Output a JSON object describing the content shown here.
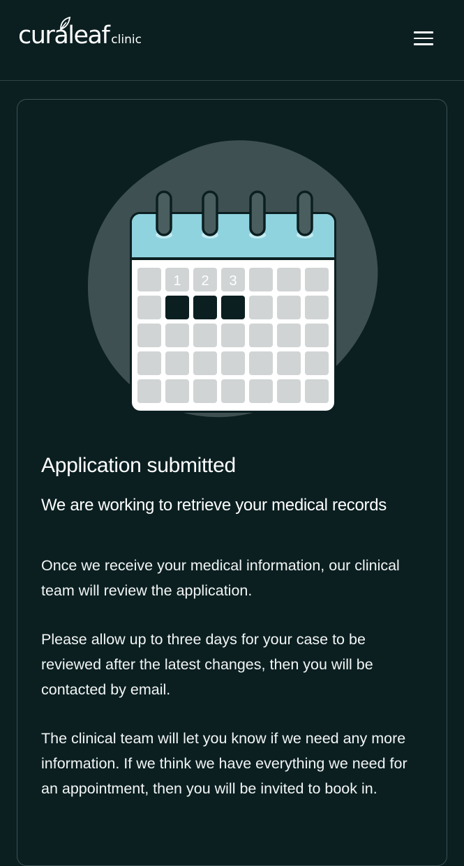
{
  "header": {
    "logo_main": "curaleaf",
    "logo_sub": "clinic"
  },
  "main": {
    "calendar_days": [
      "1",
      "2",
      "3"
    ],
    "title": "Application submitted",
    "subtitle": "We are working to retrieve your medical records",
    "paragraphs": [
      "Once we receive your medical information, our clinical team will review the application.",
      "Please allow up to three days for your case to be reviewed after the latest changes, then you will be contacted by email.",
      "The clinical team will let you know if we need any more information. If we think we have everything we need for an appointment, then you will be invited to book in."
    ]
  },
  "colors": {
    "background": "#0b1f21",
    "blob": "#3f5052",
    "calendar_header": "#8fd3df",
    "cell": "#d0d4d5",
    "highlight": "#0b1f21"
  },
  "icons": {
    "menu": "hamburger-menu-icon",
    "calendar": "calendar-illustration",
    "leaf": "leaf-icon"
  }
}
